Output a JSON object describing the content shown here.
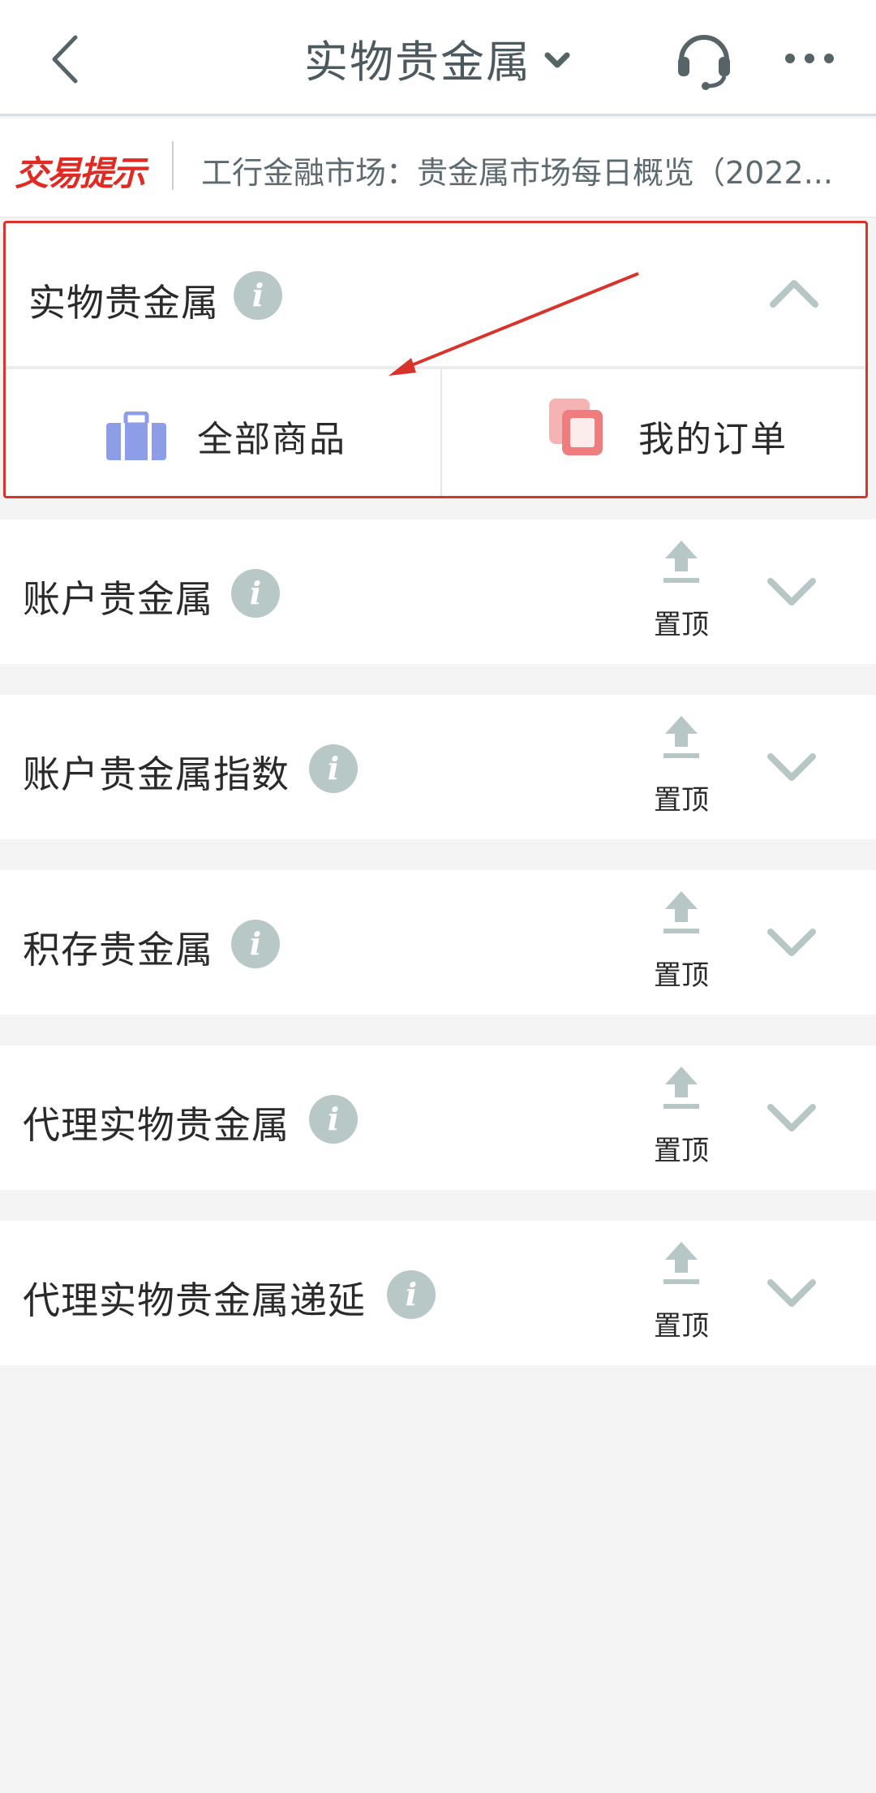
{
  "header": {
    "title": "实物贵金属",
    "back_icon": "back-arrow-icon",
    "support_icon": "headset-icon",
    "more_icon": "more-dots-icon"
  },
  "ticker": {
    "tag": "交易提示",
    "text": "工行金融市场：贵金属市场每日概览（2022..."
  },
  "expanded_section": {
    "title": "实物贵金属",
    "sub_buttons": [
      {
        "label": "全部商品",
        "icon": "briefcase-icon"
      },
      {
        "label": "我的订单",
        "icon": "order-copy-icon"
      }
    ]
  },
  "sections": [
    {
      "title": "账户贵金属",
      "pin_label": "置顶"
    },
    {
      "title": "账户贵金属指数",
      "pin_label": "置顶"
    },
    {
      "title": "积存贵金属",
      "pin_label": "置顶"
    },
    {
      "title": "代理实物贵金属",
      "pin_label": "置顶"
    },
    {
      "title": "代理实物贵金属递延",
      "pin_label": "置顶"
    }
  ],
  "colors": {
    "accent_red": "#d9342b",
    "icon_gray_green": "#b7c7c5",
    "info_bg": "#b8c8c6",
    "briefcase_blue": "#8d9de8",
    "order_red": "#ef7d7d"
  }
}
